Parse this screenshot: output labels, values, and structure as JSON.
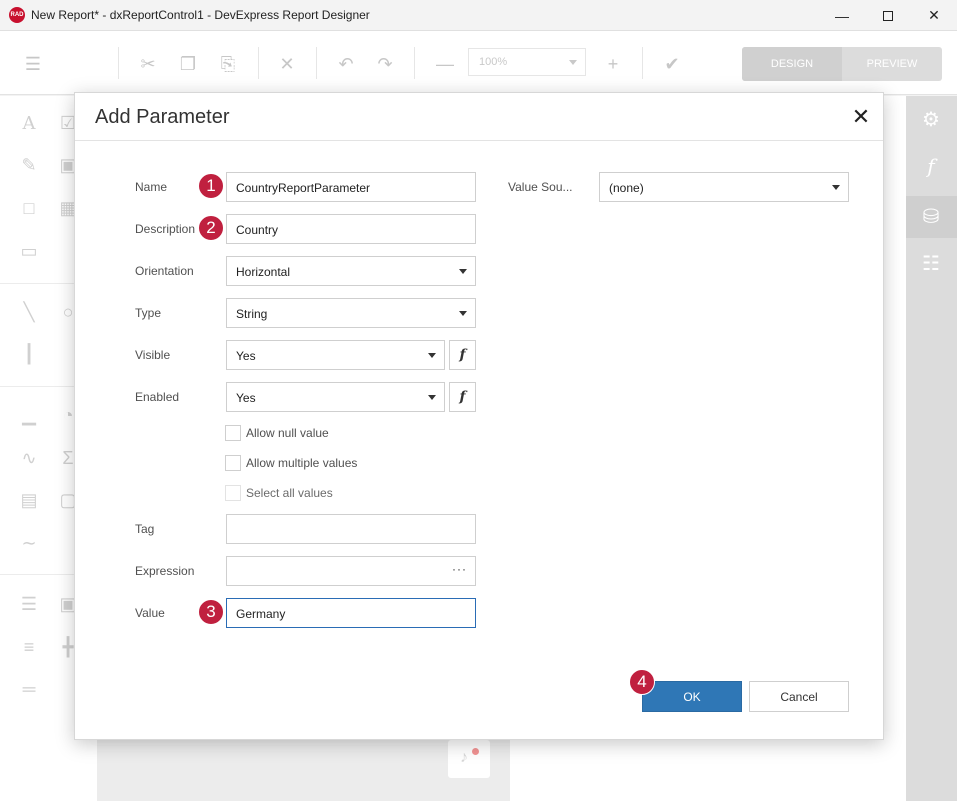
{
  "window": {
    "title": "New Report* - dxReportControl1 - DevExpress Report Designer",
    "app_icon": "RAD",
    "controls": [
      "minimize-icon",
      "maximize-icon",
      "close-icon"
    ]
  },
  "toolbar": {
    "zoom_value": "100%",
    "modes": [
      "DESIGN",
      "PREVIEW"
    ],
    "icons": [
      "menu-icon",
      "cut-icon",
      "copy-icon",
      "paste-icon",
      "delete-icon",
      "undo-icon",
      "redo-icon",
      "zoom-out-icon",
      "zoom-in-icon",
      "validate-icon"
    ]
  },
  "dialog": {
    "title": "Add Parameter",
    "fields": {
      "name": {
        "label": "Name",
        "value": "CountryReportParameter"
      },
      "description": {
        "label": "Description",
        "value": "Country"
      },
      "orientation": {
        "label": "Orientation",
        "value": "Horizontal"
      },
      "type": {
        "label": "Type",
        "value": "String"
      },
      "visible": {
        "label": "Visible",
        "value": "Yes"
      },
      "enabled": {
        "label": "Enabled",
        "value": "Yes"
      },
      "tag": {
        "label": "Tag",
        "value": ""
      },
      "expression": {
        "label": "Expression",
        "value": "",
        "button": "···"
      },
      "value": {
        "label": "Value",
        "value": "Germany"
      },
      "value_source": {
        "label": "Value Sou...",
        "value": "(none)"
      }
    },
    "fx_symbol": "f",
    "checkboxes": [
      {
        "label": "Allow null value",
        "checked": false,
        "enabled": true
      },
      {
        "label": "Allow multiple values",
        "checked": false,
        "enabled": true
      },
      {
        "label": "Select all values",
        "checked": false,
        "enabled": false
      }
    ],
    "buttons": {
      "ok": "OK",
      "cancel": "Cancel"
    },
    "badges": [
      "1",
      "2",
      "3",
      "4"
    ],
    "badge_color": "#c0203f",
    "accent_color": "#2f77b6"
  }
}
